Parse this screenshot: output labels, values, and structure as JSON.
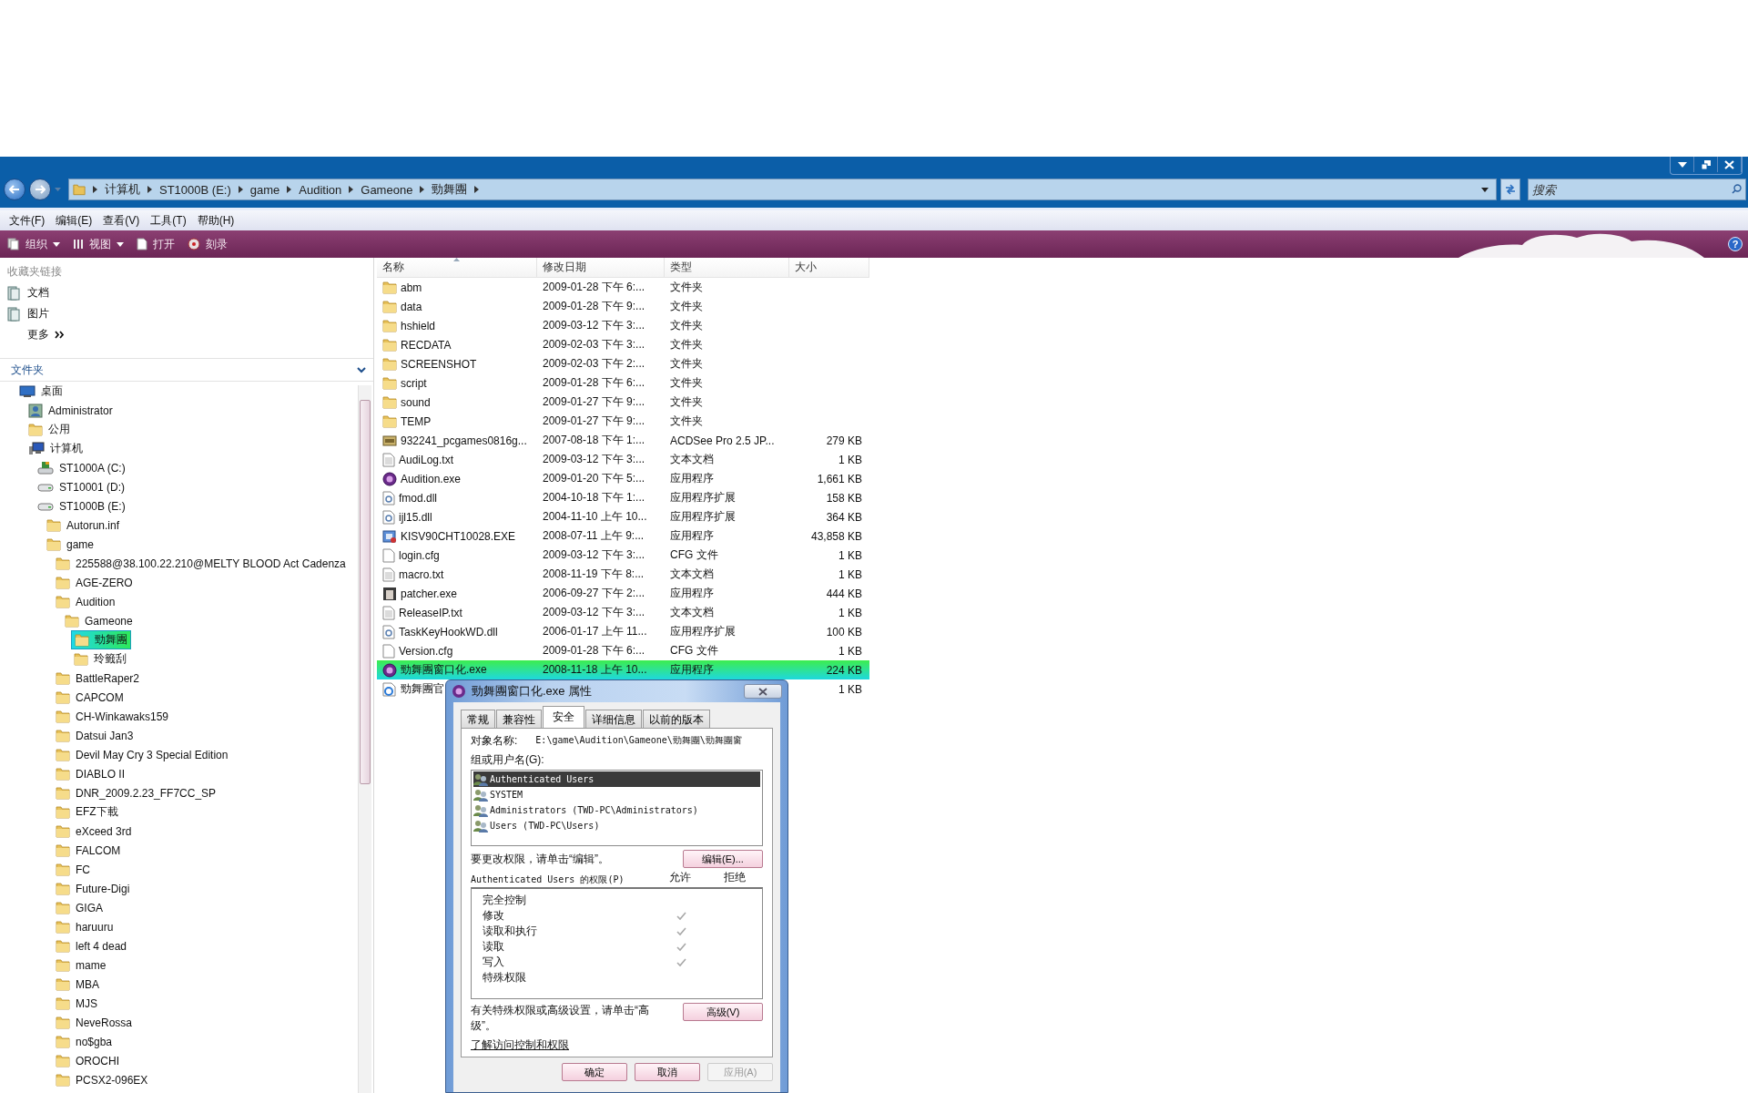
{
  "address_bar": {
    "crumbs": [
      "计算机",
      "ST1000B (E:)",
      "game",
      "Audition",
      "Gameone",
      "勁舞團"
    ],
    "search": {
      "placeholder": "搜索"
    }
  },
  "menu_bar": [
    "文件(F)",
    "编辑(E)",
    "查看(V)",
    "工具(T)",
    "帮助(H)"
  ],
  "toolbar": {
    "items": [
      {
        "label": "组织",
        "kind": "organize",
        "dropdown": true
      },
      {
        "label": "视图",
        "kind": "views",
        "dropdown": true
      },
      {
        "label": "打开",
        "kind": "open",
        "dropdown": false
      },
      {
        "label": "刻录",
        "kind": "burn",
        "dropdown": false
      }
    ],
    "help": "?"
  },
  "favorite_links": {
    "title": "收藏夹链接",
    "items": [
      "文档",
      "图片"
    ],
    "more": "更多"
  },
  "folders": {
    "title": "文件夹",
    "tree": [
      {
        "label": "桌面",
        "kind": "desktop",
        "selected": false,
        "children": [
          {
            "label": "Administrator",
            "kind": "user",
            "selected": false
          },
          {
            "label": "公用",
            "kind": "folder",
            "selected": false
          },
          {
            "label": "计算机",
            "kind": "computer",
            "selected": false,
            "children": [
              {
                "label": "ST1000A (C:)",
                "kind": "system-drive",
                "selected": false
              },
              {
                "label": "ST10001 (D:)",
                "kind": "drive",
                "selected": false
              },
              {
                "label": "ST1000B (E:)",
                "kind": "drive",
                "selected": false,
                "children": [
                  {
                    "label": "Autorun.inf",
                    "kind": "folder",
                    "selected": false
                  },
                  {
                    "label": "game",
                    "kind": "folder",
                    "selected": false,
                    "children": [
                      {
                        "label": "225588@38.100.22.210@MELTY BLOOD Act Cadenza",
                        "kind": "folder",
                        "selected": false
                      },
                      {
                        "label": "AGE-ZERO",
                        "kind": "folder",
                        "selected": false
                      },
                      {
                        "label": "Audition",
                        "kind": "folder",
                        "selected": false,
                        "children": [
                          {
                            "label": "Gameone",
                            "kind": "folder",
                            "selected": false,
                            "children": [
                              {
                                "label": "勁舞團",
                                "kind": "folder",
                                "selected": true
                              },
                              {
                                "label": "玲籤刮",
                                "kind": "folder",
                                "selected": false
                              }
                            ]
                          }
                        ]
                      },
                      {
                        "label": "BattleRaper2",
                        "kind": "folder",
                        "selected": false
                      },
                      {
                        "label": "CAPCOM",
                        "kind": "folder",
                        "selected": false
                      },
                      {
                        "label": "CH-Winkawaks159",
                        "kind": "folder",
                        "selected": false
                      },
                      {
                        "label": "Datsui Jan3",
                        "kind": "folder",
                        "selected": false
                      },
                      {
                        "label": "Devil May Cry 3 Special Edition",
                        "kind": "folder",
                        "selected": false
                      },
                      {
                        "label": "DIABLO II",
                        "kind": "folder",
                        "selected": false
                      },
                      {
                        "label": "DNR_2009.2.23_FF7CC_SP",
                        "kind": "folder",
                        "selected": false
                      },
                      {
                        "label": "EFZ下載",
                        "kind": "folder",
                        "selected": false
                      },
                      {
                        "label": "eXceed 3rd",
                        "kind": "folder",
                        "selected": false
                      },
                      {
                        "label": "FALCOM",
                        "kind": "folder",
                        "selected": false
                      },
                      {
                        "label": "FC",
                        "kind": "folder",
                        "selected": false
                      },
                      {
                        "label": "Future-Digi",
                        "kind": "folder",
                        "selected": false
                      },
                      {
                        "label": "GIGA",
                        "kind": "folder",
                        "selected": false
                      },
                      {
                        "label": "haruuru",
                        "kind": "folder",
                        "selected": false
                      },
                      {
                        "label": "left 4 dead",
                        "kind": "folder",
                        "selected": false
                      },
                      {
                        "label": "mame",
                        "kind": "folder",
                        "selected": false
                      },
                      {
                        "label": "MBA",
                        "kind": "folder",
                        "selected": false
                      },
                      {
                        "label": "MJS",
                        "kind": "folder",
                        "selected": false
                      },
                      {
                        "label": "NeveRossa",
                        "kind": "folder",
                        "selected": false
                      },
                      {
                        "label": "no$gba",
                        "kind": "folder",
                        "selected": false
                      },
                      {
                        "label": "OROCHI",
                        "kind": "folder",
                        "selected": false
                      },
                      {
                        "label": "PCSX2-096EX",
                        "kind": "folder",
                        "selected": false
                      }
                    ]
                  }
                ]
              }
            ]
          }
        ]
      }
    ]
  },
  "file_list": {
    "columns": [
      "名称",
      "修改日期",
      "类型",
      "大小"
    ],
    "rows": [
      {
        "name": "abm",
        "date": "2009-01-28 下午 6:...",
        "type": "文件夹",
        "size": "",
        "kind": "folder",
        "selected": false
      },
      {
        "name": "data",
        "date": "2009-01-28 下午 9:...",
        "type": "文件夹",
        "size": "",
        "kind": "folder",
        "selected": false
      },
      {
        "name": "hshield",
        "date": "2009-03-12 下午 3:...",
        "type": "文件夹",
        "size": "",
        "kind": "folder",
        "selected": false
      },
      {
        "name": "RECDATA",
        "date": "2009-02-03 下午 3:...",
        "type": "文件夹",
        "size": "",
        "kind": "folder",
        "selected": false
      },
      {
        "name": "SCREENSHOT",
        "date": "2009-02-03 下午 2:...",
        "type": "文件夹",
        "size": "",
        "kind": "folder",
        "selected": false
      },
      {
        "name": "script",
        "date": "2009-01-28 下午 6:...",
        "type": "文件夹",
        "size": "",
        "kind": "folder",
        "selected": false
      },
      {
        "name": "sound",
        "date": "2009-01-27 下午 9:...",
        "type": "文件夹",
        "size": "",
        "kind": "folder",
        "selected": false
      },
      {
        "name": "TEMP",
        "date": "2009-01-27 下午 9:...",
        "type": "文件夹",
        "size": "",
        "kind": "folder",
        "selected": false
      },
      {
        "name": "932241_pcgames0816g...",
        "date": "2007-08-18 下午 1:...",
        "type": "ACDSee Pro 2.5 JP...",
        "size": "279 KB",
        "kind": "image",
        "selected": false
      },
      {
        "name": "AudiLog.txt",
        "date": "2009-03-12 下午 3:...",
        "type": "文本文档",
        "size": "1 KB",
        "kind": "text",
        "selected": false
      },
      {
        "name": "Audition.exe",
        "date": "2009-01-20 下午 5:...",
        "type": "应用程序",
        "size": "1,661 KB",
        "kind": "app",
        "selected": false
      },
      {
        "name": "fmod.dll",
        "date": "2004-10-18 下午 1:...",
        "type": "应用程序扩展",
        "size": "158 KB",
        "kind": "dll",
        "selected": false
      },
      {
        "name": "ijl15.dll",
        "date": "2004-11-10 上午 10...",
        "type": "应用程序扩展",
        "size": "364 KB",
        "kind": "dll",
        "selected": false
      },
      {
        "name": "KISV90CHT10028.EXE",
        "date": "2008-07-11 上午 9:...",
        "type": "应用程序",
        "size": "43,858 KB",
        "kind": "installer",
        "selected": false
      },
      {
        "name": "login.cfg",
        "date": "2009-03-12 下午 3:...",
        "type": "CFG 文件",
        "size": "1 KB",
        "kind": "cfg",
        "selected": false
      },
      {
        "name": "macro.txt",
        "date": "2008-11-19 下午 8:...",
        "type": "文本文档",
        "size": "1 KB",
        "kind": "text",
        "selected": false
      },
      {
        "name": "patcher.exe",
        "date": "2006-09-27 下午 2:...",
        "type": "应用程序",
        "size": "444 KB",
        "kind": "patcher",
        "selected": false
      },
      {
        "name": "ReleaseIP.txt",
        "date": "2009-03-12 下午 3:...",
        "type": "文本文档",
        "size": "1 KB",
        "kind": "text",
        "selected": false
      },
      {
        "name": "TaskKeyHookWD.dll",
        "date": "2006-01-17 上午 11...",
        "type": "应用程序扩展",
        "size": "100 KB",
        "kind": "dll",
        "selected": false
      },
      {
        "name": "Version.cfg",
        "date": "2009-01-28 下午 6:...",
        "type": "CFG 文件",
        "size": "1 KB",
        "kind": "cfg",
        "selected": false
      },
      {
        "name": "勁舞團窗口化.exe",
        "date": "2008-11-18 上午 10...",
        "type": "应用程序",
        "size": "224 KB",
        "kind": "app",
        "selected": true
      },
      {
        "name": "勁舞團官",
        "date": "",
        "type": "",
        "size": "1 KB",
        "kind": "web",
        "selected": false
      }
    ]
  },
  "properties_dialog": {
    "title": "勁舞團窗口化.exe 属性",
    "tabs": [
      {
        "label": "常规",
        "selected": false
      },
      {
        "label": "兼容性",
        "selected": false
      },
      {
        "label": "安全",
        "selected": true
      },
      {
        "label": "详细信息",
        "selected": false
      },
      {
        "label": "以前的版本",
        "selected": false
      }
    ],
    "object_label": "对象名称:",
    "object_value": "E:\\game\\Audition\\Gameone\\勁舞團\\勁舞團窗",
    "groups_label": "组或用户名(G):",
    "groups": [
      {
        "label": "Authenticated Users",
        "selected": true
      },
      {
        "label": "SYSTEM",
        "selected": false
      },
      {
        "label": "Administrators (TWD-PC\\Administrators)",
        "selected": false
      },
      {
        "label": "Users (TWD-PC\\Users)",
        "selected": false
      }
    ],
    "edit_hint": "要更改权限，请单击“编辑”。",
    "edit_button": "编辑(E)...",
    "permissions_label": "Authenticated Users 的权限(P)",
    "allow_header": "允许",
    "deny_header": "拒绝",
    "permissions": [
      {
        "label": "完全控制",
        "allow": false,
        "deny": false
      },
      {
        "label": "修改",
        "allow": true,
        "deny": false
      },
      {
        "label": "读取和执行",
        "allow": true,
        "deny": false
      },
      {
        "label": "读取",
        "allow": true,
        "deny": false
      },
      {
        "label": "写入",
        "allow": true,
        "deny": false
      },
      {
        "label": "特殊权限",
        "allow": false,
        "deny": false
      }
    ],
    "advanced_hint": "有关特殊权限或高级设置，请单击“高级”。",
    "advanced_button": "高级(V)",
    "learn_link": "了解访问控制和权限",
    "buttons": [
      {
        "label": "确定",
        "disabled": false
      },
      {
        "label": "取消",
        "disabled": false
      },
      {
        "label": "应用(A)",
        "disabled": true
      }
    ]
  }
}
